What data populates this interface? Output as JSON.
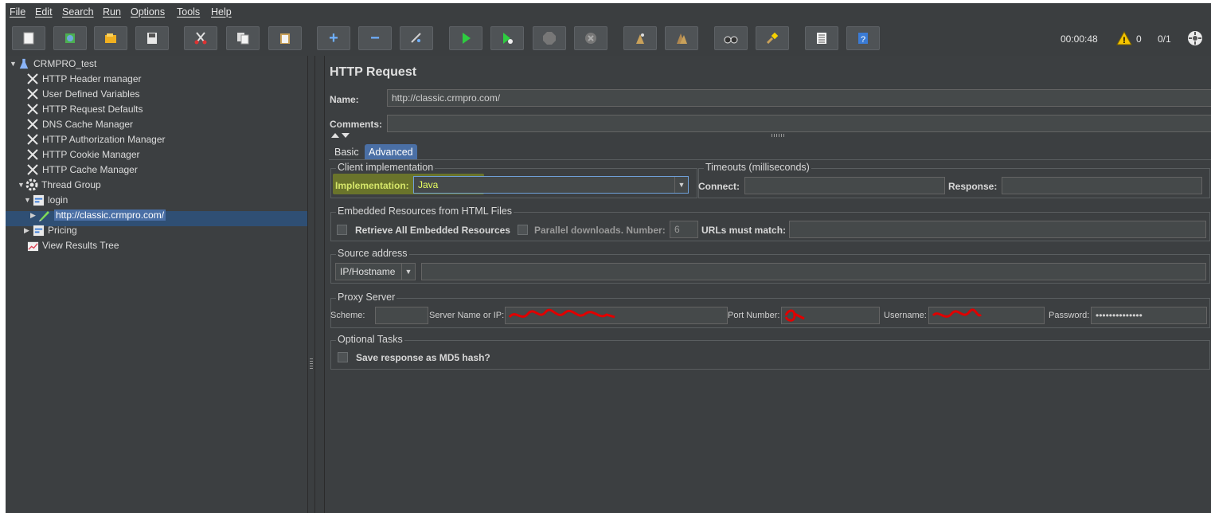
{
  "menu": [
    "File",
    "Edit",
    "Search",
    "Run",
    "Options",
    "Tools",
    "Help"
  ],
  "toolbar": {
    "icons": [
      "new-icon",
      "templates-icon",
      "open-icon",
      "save-icon",
      "cut-icon",
      "copy-icon",
      "paste-icon",
      "expand-icon",
      "collapse-icon",
      "toggle-icon",
      "start-icon",
      "start-no-pauses-icon",
      "stop-icon",
      "shutdown-icon",
      "clear-icon",
      "clear-all-icon",
      "search-icon",
      "reset-search-icon",
      "function-helper-icon",
      "help-icon"
    ],
    "timer": "00:00:48",
    "warnings": "0",
    "threads": "0/1"
  },
  "tree": {
    "root": "CRMPRO_test",
    "items": [
      "HTTP Header manager",
      "User Defined Variables",
      "HTTP Request Defaults",
      "DNS Cache Manager",
      "HTTP Authorization Manager",
      "HTTP Cookie Manager",
      "HTTP Cache Manager"
    ],
    "thread_group": "Thread Group",
    "login": "login",
    "selected": "http://classic.crmpro.com/",
    "pricing": "Pricing",
    "results": "View Results Tree"
  },
  "panel": {
    "title": "HTTP Request",
    "name_label": "Name:",
    "name_value": "http://classic.crmpro.com/",
    "comments_label": "Comments:",
    "comments_value": "",
    "tabs": [
      "Basic",
      "Advanced"
    ],
    "client": {
      "title": "Client implementation",
      "impl_label": "Implementation:",
      "impl_value": "Java"
    },
    "timeouts": {
      "title": "Timeouts (milliseconds)",
      "connect_label": "Connect:",
      "connect_value": "",
      "response_label": "Response:",
      "response_value": ""
    },
    "embedded": {
      "title": "Embedded Resources from HTML Files",
      "retrieve_label": "Retrieve All Embedded Resources",
      "parallel_label": "Parallel downloads. Number:",
      "parallel_value": "6",
      "urls_label": "URLs must match:",
      "urls_value": ""
    },
    "source": {
      "title": "Source address",
      "type_value": "IP/Hostname",
      "address_value": ""
    },
    "proxy": {
      "title": "Proxy Server",
      "scheme_label": "Scheme:",
      "scheme_value": "",
      "server_label": "Server Name or IP:",
      "port_label": "Port Number:",
      "user_label": "Username:",
      "password_label": "Password:",
      "password_value": "••••••••••••••"
    },
    "optional": {
      "title": "Optional Tasks",
      "md5_label": "Save response as MD5 hash?"
    }
  },
  "colors": {
    "highlight": "#c8e000",
    "selection": "#4a6fa5",
    "redaction": "#e00000"
  }
}
